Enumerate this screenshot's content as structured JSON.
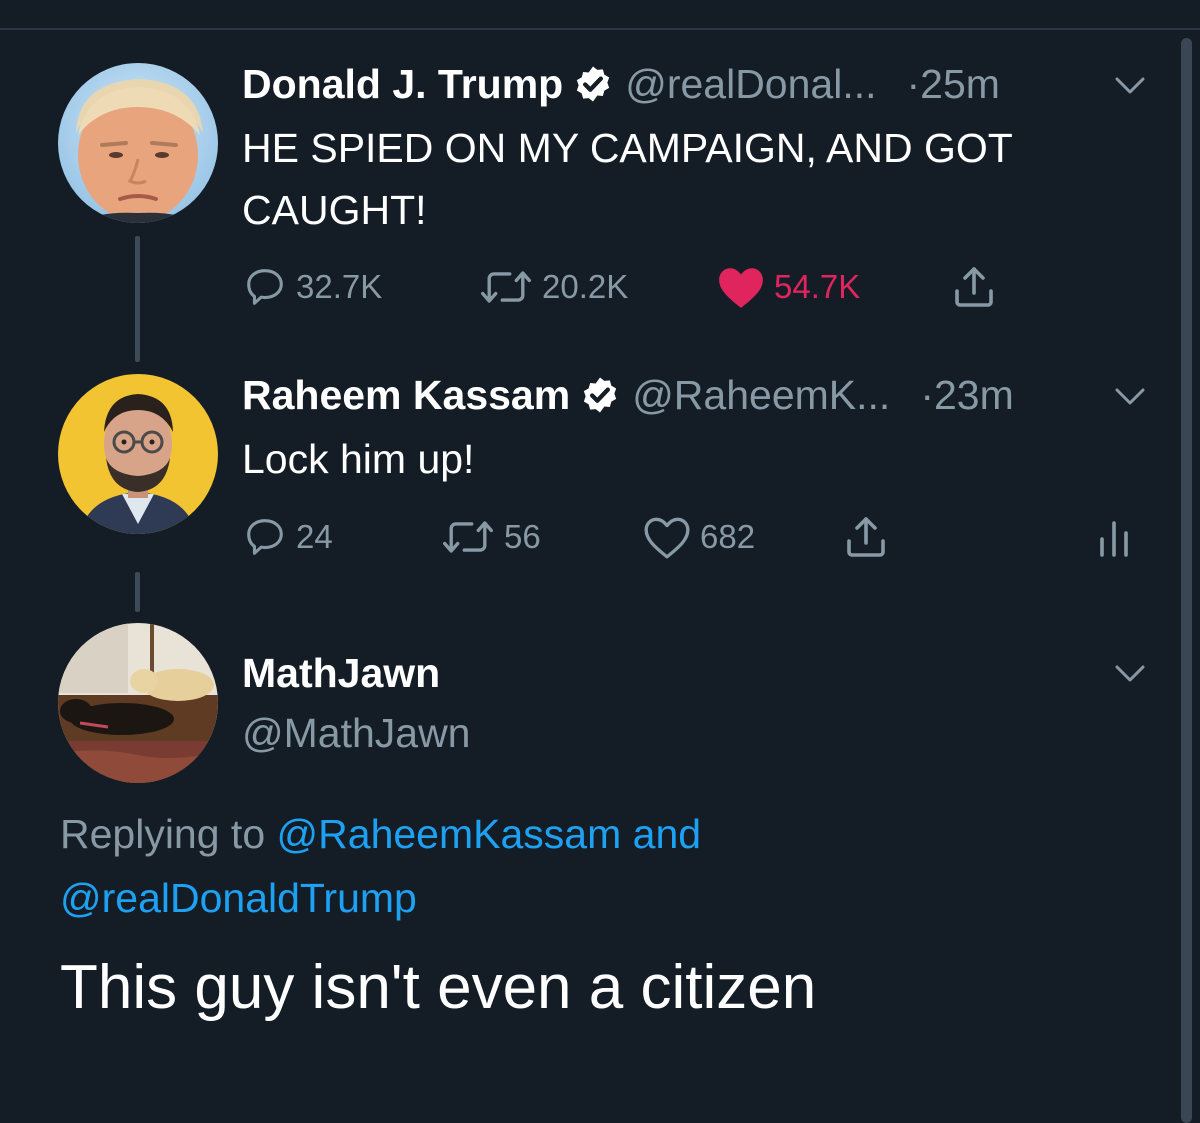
{
  "tweets": [
    {
      "name": "Donald J. Trump",
      "handle": "@realDonal...",
      "dot": "·",
      "time": "25m",
      "text": "HE SPIED ON MY CAMPAIGN, AND GOT CAUGHT!",
      "replies": "32.7K",
      "retweets": "20.2K",
      "likes": "54.7K",
      "liked": true
    },
    {
      "name": "Raheem Kassam",
      "handle": "@RaheemK...",
      "dot": "·",
      "time": "23m",
      "text": "Lock him up!",
      "replies": "24",
      "retweets": "56",
      "likes": "682",
      "liked": false
    }
  ],
  "reply": {
    "name": "MathJawn",
    "handle": "@MathJawn",
    "replying_prefix": "Replying to",
    "replying_to_1": "@RaheemKassam",
    "replying_and": "and",
    "replying_to_2": "@realDonaldTrump",
    "text": "This guy isn't even a citizen"
  },
  "colors": {
    "background": "#141d26",
    "muted": "#8899a6",
    "link": "#1da1f2",
    "like": "#e0245e"
  },
  "icons": [
    "verified-icon",
    "chevron-down-icon",
    "reply-icon",
    "retweet-icon",
    "heart-icon",
    "share-icon",
    "analytics-icon"
  ]
}
